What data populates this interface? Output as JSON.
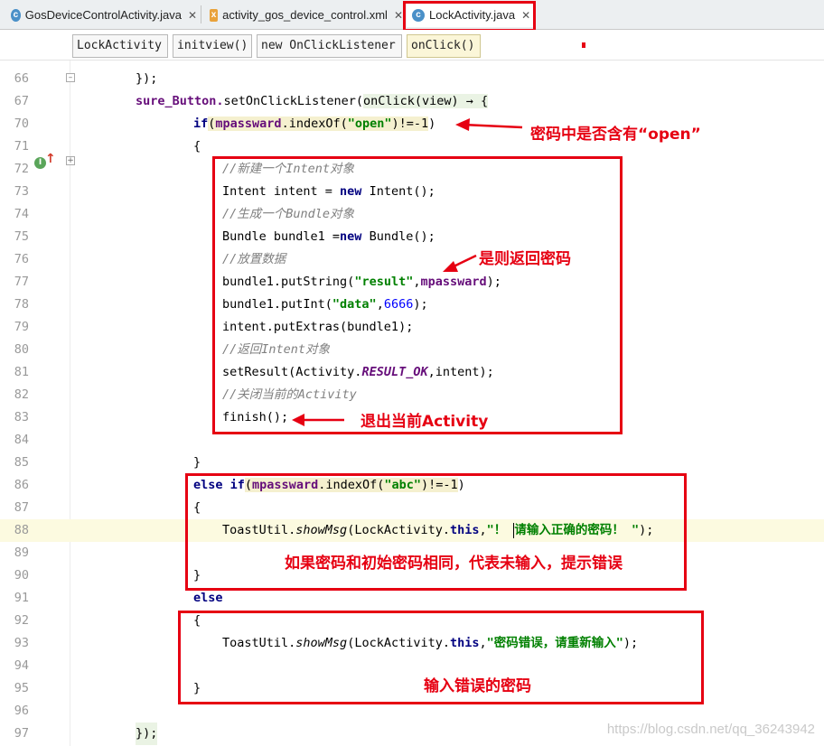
{
  "tabs": [
    {
      "label": "GosDeviceControlActivity.java",
      "icon": "java-class-icon"
    },
    {
      "label": "activity_gos_device_control.xml",
      "icon": "xml-file-icon"
    },
    {
      "label": "LockActivity.java",
      "icon": "java-class-icon",
      "active": true
    }
  ],
  "breadcrumbs": [
    "LockActivity",
    "initview()",
    "new OnClickListener",
    "onClick()"
  ],
  "lines": {
    "l66": {
      "num": "66",
      "text": "});"
    },
    "l67": {
      "num": "67",
      "a": "sure_Button.",
      "b": "setOnClickListener(",
      "c": "onClick(view) → {"
    },
    "l70": {
      "num": "70",
      "a": "if",
      "b": "(",
      "c": "mpassward",
      "d": ".indexOf(",
      "e": "\"open\"",
      "f": ")!=-1",
      "g": ")"
    },
    "l71": {
      "num": "71",
      "text": "{"
    },
    "l72": {
      "num": "72",
      "a": "//新建一个",
      "b": "Intent",
      "c": "对象"
    },
    "l73": {
      "num": "73",
      "a": "Intent intent = ",
      "b": "new",
      "c": " Intent();"
    },
    "l74": {
      "num": "74",
      "a": "//生成一个",
      "b": "Bundle",
      "c": "对象"
    },
    "l75": {
      "num": "75",
      "a": "Bundle bundle1 =",
      "b": "new",
      "c": " Bundle();"
    },
    "l76": {
      "num": "76",
      "text": "//放置数据"
    },
    "l77": {
      "num": "77",
      "a": "bundle1.putString(",
      "b": "\"result\"",
      "c": ",",
      "d": "mpassward",
      "e": ");"
    },
    "l78": {
      "num": "78",
      "a": "bundle1.putInt(",
      "b": "\"data\"",
      "c": ",",
      "d": "6666",
      "e": ");"
    },
    "l79": {
      "num": "79",
      "text": "intent.putExtras(bundle1);"
    },
    "l80": {
      "num": "80",
      "a": "//返回",
      "b": "Intent",
      "c": "对象"
    },
    "l81": {
      "num": "81",
      "a": "setResult(Activity.",
      "b": "RESULT_OK",
      "c": ",intent);"
    },
    "l82": {
      "num": "82",
      "a": "//关闭当前的",
      "b": "Activity"
    },
    "l83": {
      "num": "83",
      "text": "finish();"
    },
    "l84": {
      "num": "84"
    },
    "l85": {
      "num": "85",
      "text": "}"
    },
    "l86": {
      "num": "86",
      "a": "else if",
      "b": "(",
      "c": "mpassward",
      "d": ".indexOf(",
      "e": "\"abc\"",
      "f": ")!=-1",
      "g": ")"
    },
    "l87": {
      "num": "87",
      "text": "{"
    },
    "l88": {
      "num": "88",
      "a": "ToastUtil.",
      "b": "showMsg",
      "c": "(LockActivity.",
      "d": "this",
      "e": ",",
      "f": "\"！ ",
      "g": "请输入正确的密码！ \"",
      "h": ");"
    },
    "l89": {
      "num": "89"
    },
    "l90": {
      "num": "90",
      "text": "}"
    },
    "l91": {
      "num": "91",
      "text": "else"
    },
    "l92": {
      "num": "92",
      "text": "{"
    },
    "l93": {
      "num": "93",
      "a": "ToastUtil.",
      "b": "showMsg",
      "c": "(LockActivity.",
      "d": "this",
      "e": ",",
      "f": "\"密码错误，请重新输入\"",
      "g": ");"
    },
    "l94": {
      "num": "94"
    },
    "l95": {
      "num": "95",
      "text": "}"
    },
    "l96": {
      "num": "96"
    },
    "l97": {
      "num": "97",
      "text": "});"
    }
  },
  "annotations": {
    "contains_open": "密码中是否含有“open”",
    "return_password": "是则返回密码",
    "exit_activity": "退出当前Activity",
    "same_as_initial": "如果密码和初始密码相同，代表未输入，提示错误",
    "wrong_password": "输入错误的密码"
  },
  "watermark": "https://blog.csdn.net/qq_36243942",
  "colors": {
    "annotation": "#e60012",
    "keyword": "#000080",
    "field": "#660e7a",
    "string": "#008000",
    "number": "#0000ff",
    "comment": "#808080"
  }
}
